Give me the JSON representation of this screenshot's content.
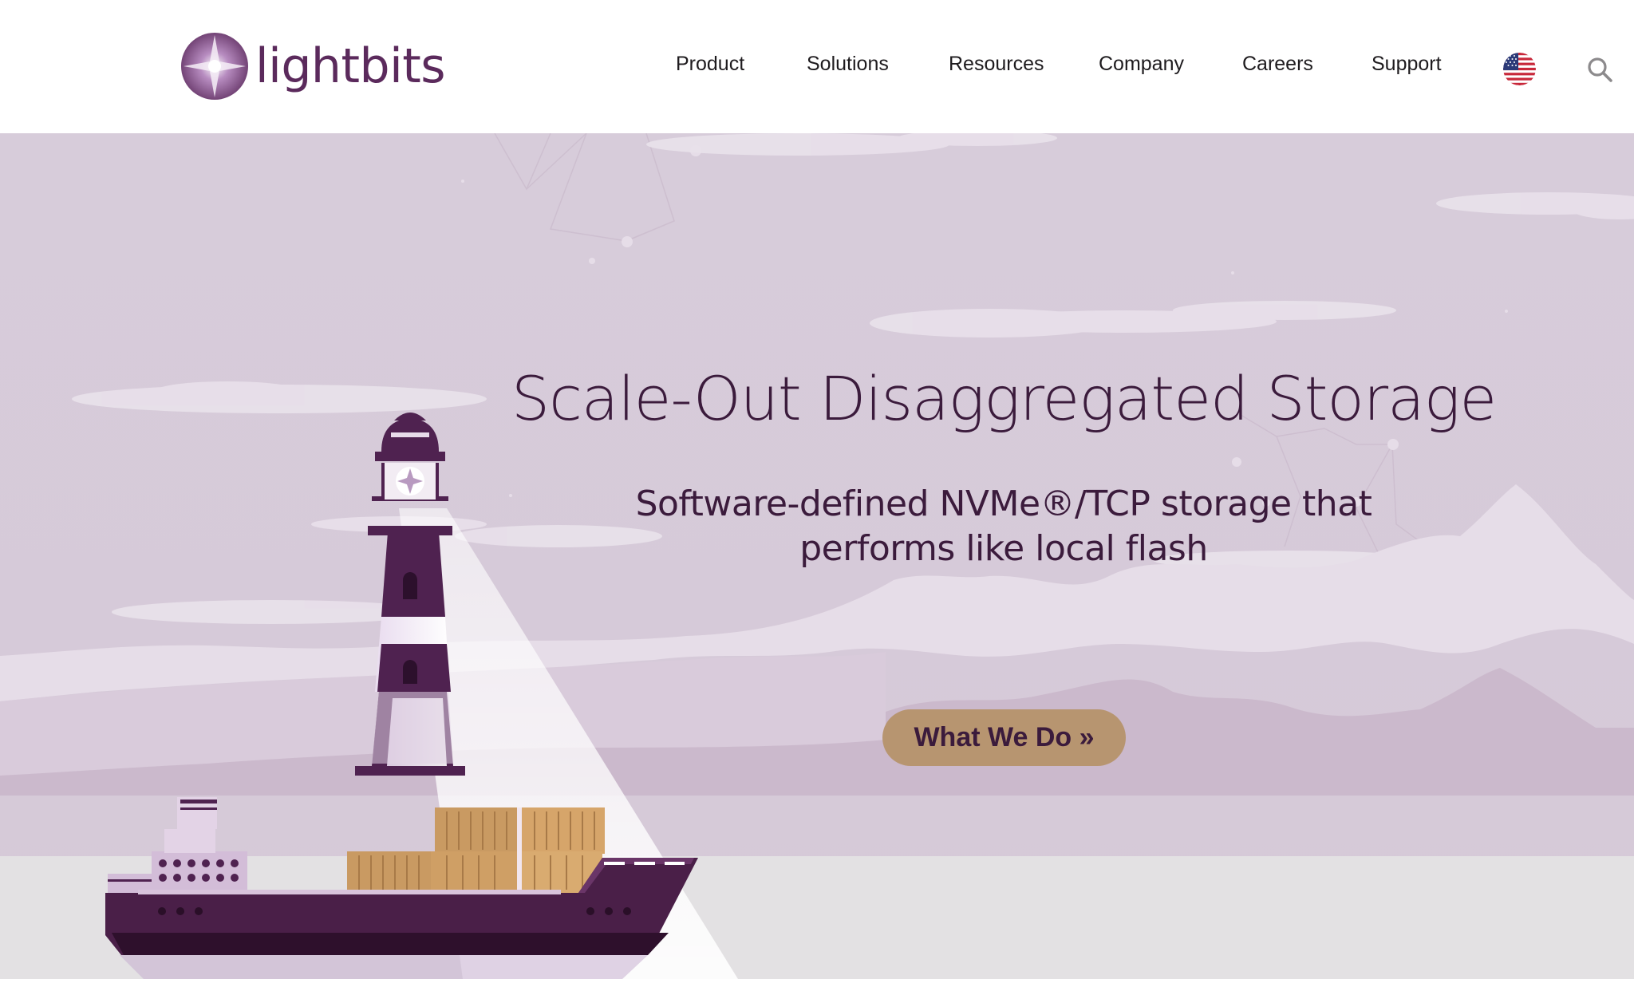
{
  "brand": {
    "name": "lightbits",
    "color": "#5b2a5c"
  },
  "nav": {
    "items": [
      {
        "label": "Product"
      },
      {
        "label": "Solutions"
      },
      {
        "label": "Resources"
      },
      {
        "label": "Company"
      },
      {
        "label": "Careers"
      },
      {
        "label": "Support"
      }
    ],
    "language_icon": "us-flag-icon",
    "search_icon": "search-icon"
  },
  "hero": {
    "title": "Scale-Out Disaggregated Storage",
    "subtitle_line1": "Software-defined NVMe®/TCP storage that",
    "subtitle_line2": "performs like local flash",
    "cta_label": "What We Do »",
    "colors": {
      "sky": "#d8cdd9",
      "text": "#3b1b3c",
      "button": "#b79570",
      "sea": "#e3e1e3",
      "ship_hull": "#4a1f48",
      "containers": "#c99a62"
    }
  }
}
